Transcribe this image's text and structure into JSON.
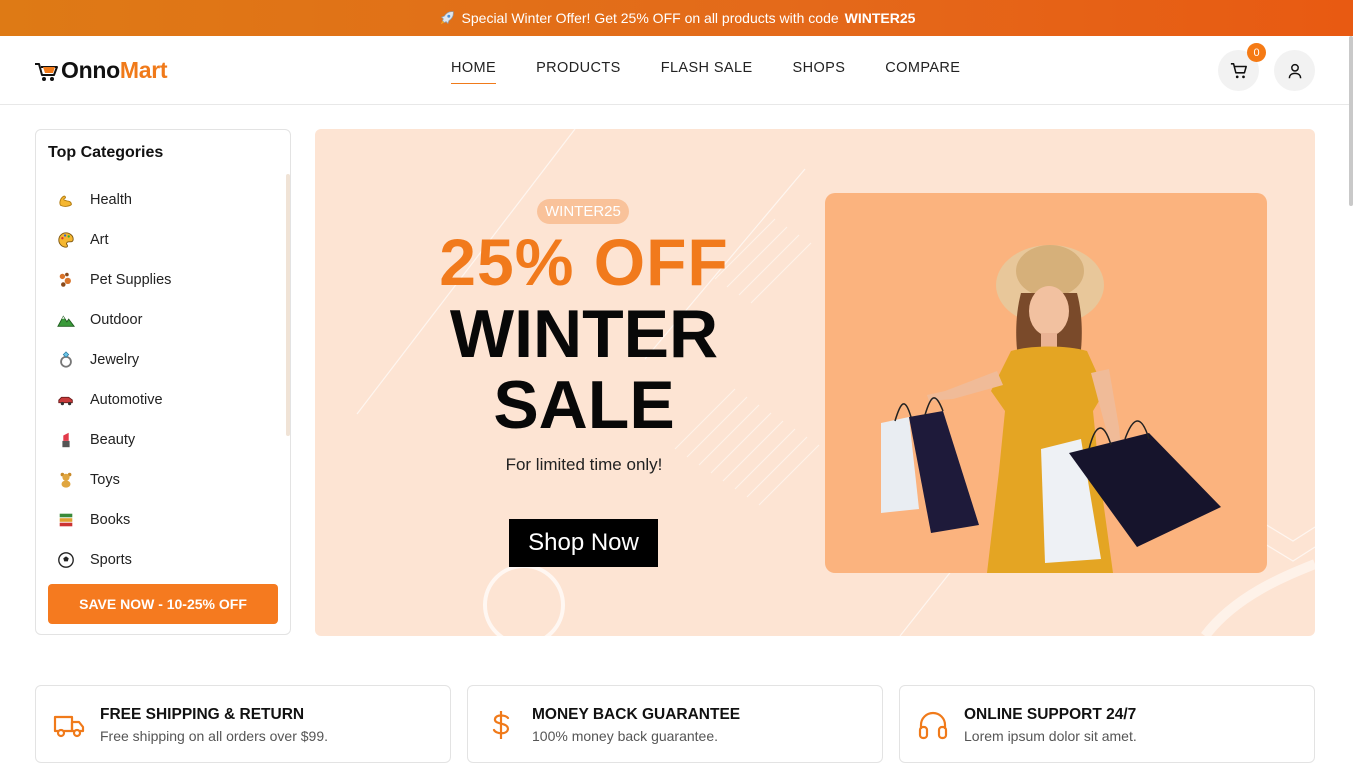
{
  "promo": {
    "text": "Special Winter Offer! Get 25% OFF on all products with code",
    "code": "WINTER25"
  },
  "logo": {
    "part1": "Onno",
    "part2": "Mart"
  },
  "nav": [
    {
      "label": "HOME"
    },
    {
      "label": "PRODUCTS"
    },
    {
      "label": "FLASH SALE"
    },
    {
      "label": "SHOPS"
    },
    {
      "label": "COMPARE"
    }
  ],
  "cart": {
    "count": "0"
  },
  "sidebar": {
    "title": "Top Categories",
    "categories": [
      {
        "label": "Health",
        "icon": "muscle-icon"
      },
      {
        "label": "Art",
        "icon": "palette-icon"
      },
      {
        "label": "Pet Supplies",
        "icon": "paw-icon"
      },
      {
        "label": "Outdoor",
        "icon": "mountain-icon"
      },
      {
        "label": "Jewelry",
        "icon": "ring-icon"
      },
      {
        "label": "Automotive",
        "icon": "car-icon"
      },
      {
        "label": "Beauty",
        "icon": "lipstick-icon"
      },
      {
        "label": "Toys",
        "icon": "teddy-bear-icon"
      },
      {
        "label": "Books",
        "icon": "books-icon"
      },
      {
        "label": "Sports",
        "icon": "soccer-ball-icon"
      }
    ],
    "save_label": "SAVE NOW - 10-25% OFF"
  },
  "hero": {
    "code": "WINTER25",
    "discount": "25% OFF",
    "title_line1": "WINTER",
    "title_line2": "SALE",
    "subtitle": "For limited time only!",
    "cta": "Shop Now"
  },
  "features": [
    {
      "title": "FREE SHIPPING & RETURN",
      "desc": "Free shipping on all orders over $99.",
      "icon": "truck-icon"
    },
    {
      "title": "MONEY BACK GUARANTEE",
      "desc": "100% money back guarantee.",
      "icon": "dollar-icon"
    },
    {
      "title": "ONLINE SUPPORT 24/7",
      "desc": "Lorem ipsum dolor sit amet.",
      "icon": "headphones-icon"
    }
  ],
  "colors": {
    "accent": "#f57a1f",
    "hero_bg": "#fde4d3",
    "promo_bg": "#e4691a"
  }
}
